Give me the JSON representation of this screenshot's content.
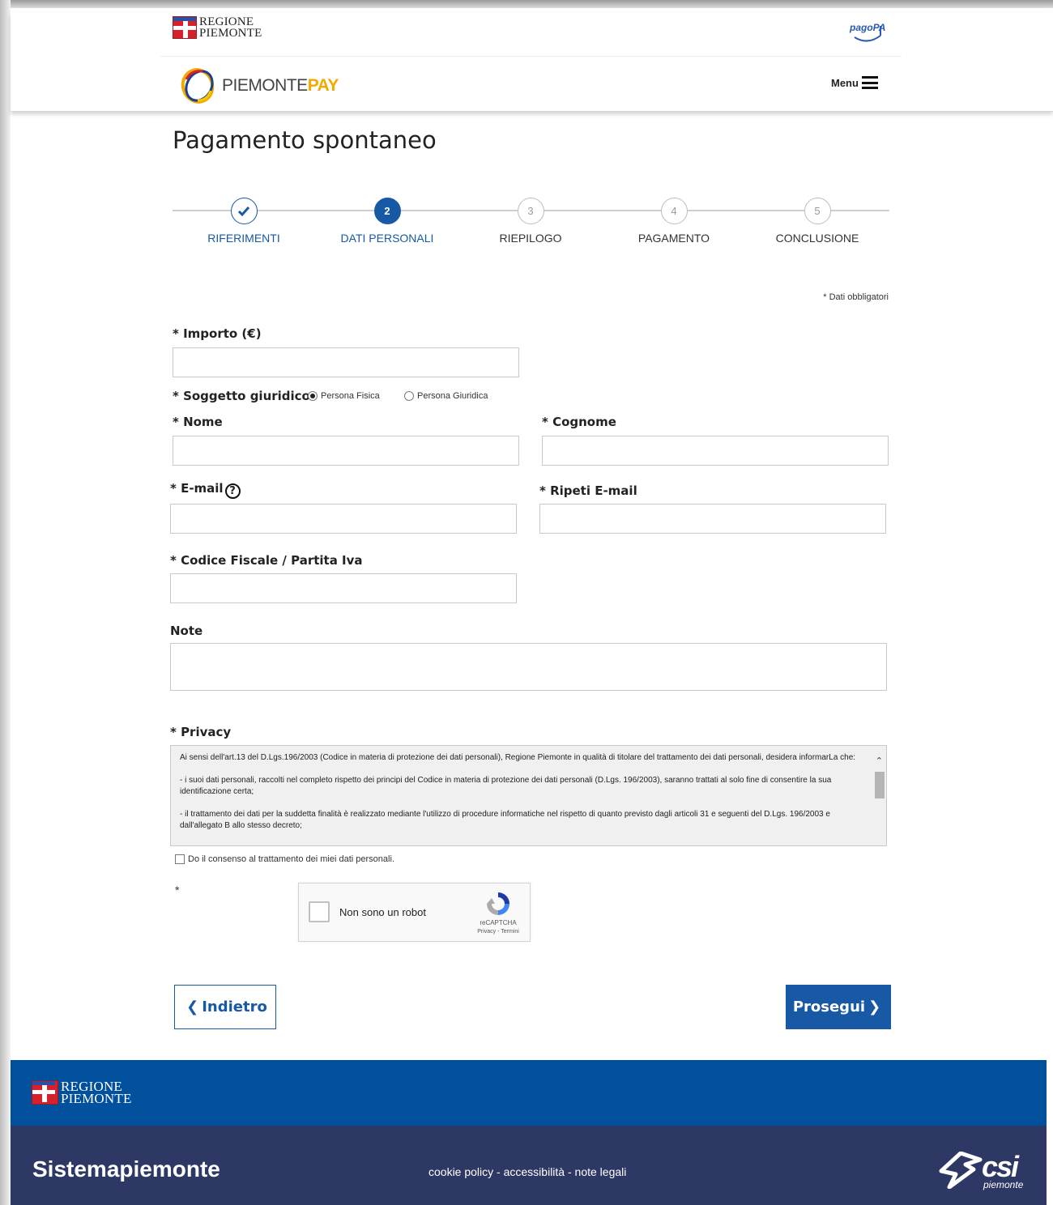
{
  "header": {
    "regione_line1": "REGIONE",
    "regione_line2": "PIEMONTE",
    "pagopa": "pagoPA",
    "brand_main": "PIEMONTE",
    "brand_accent": "PAY",
    "menu_label": "Menu"
  },
  "page_title": "Pagamento spontaneo",
  "stepper": [
    {
      "num": "",
      "label": "RIFERIMENTI",
      "state": "done"
    },
    {
      "num": "2",
      "label": "DATI PERSONALI",
      "state": "active"
    },
    {
      "num": "3",
      "label": "RIEPILOGO",
      "state": "todo"
    },
    {
      "num": "4",
      "label": "PAGAMENTO",
      "state": "todo"
    },
    {
      "num": "5",
      "label": "CONCLUSIONE",
      "state": "todo"
    }
  ],
  "required_note": "* Dati obbligatori",
  "form": {
    "importo_label": "* Importo (€)",
    "importo_value": "",
    "soggetto_label": "* Soggetto giuridico",
    "soggetto_options": [
      "Persona Fisica",
      "Persona Giuridica"
    ],
    "soggetto_selected": "Persona Fisica",
    "nome_label": "* Nome",
    "nome_value": "",
    "cognome_label": "* Cognome",
    "cognome_value": "",
    "email_label": "* E-mail",
    "email_value": "",
    "ripeti_email_label": "* Ripeti E-mail",
    "ripeti_email_value": "",
    "cf_label": "* Codice Fiscale / Partita Iva",
    "cf_value": "",
    "note_label": "Note",
    "note_value": "",
    "privacy_label": "* Privacy",
    "privacy_paragraphs": [
      "Ai sensi dell'art.13 del D.Lgs.196/2003 (Codice in materia di protezione dei dati personali), Regione Piemonte in qualità di titolare del trattamento dei dati personali, desidera informarLa che:",
      "- i suoi dati personali, raccolti nel completo rispetto dei principi del Codice in materia di protezione dei dati personali (D.Lgs. 196/2003), saranno trattati al solo fine di consentire la sua identificazione certa;",
      "- il trattamento dei dati per la suddetta finalità è realizzato mediante l'utilizzo di procedure informatiche nel rispetto di quanto previsto dagli articoli 31 e seguenti del D.Lgs. 196/2003 e dall'allegato B allo stesso decreto;"
    ],
    "consent_label": "Do il consenso al trattamento dei miei dati personali.",
    "captcha_required_mark": "*"
  },
  "recaptcha": {
    "label": "Non sono un robot",
    "brand": "reCAPTCHA",
    "links": "Privacy - Termini"
  },
  "buttons": {
    "back": "Indietro",
    "next": "Prosegui"
  },
  "footer": {
    "regione_line1": "REGIONE",
    "regione_line2": "PIEMONTE",
    "sistema": "Sistemapiemonte",
    "link_cookie": "cookie policy",
    "link_access": "accessibilità",
    "link_legal": "note legali",
    "separator": " - ",
    "csi": "csi",
    "csi_sub": "piemonte"
  },
  "colors": {
    "primary": "#1759a4",
    "footer_top": "#00509e",
    "footer_bottom": "#2d3865",
    "accent_pay": "#f2a900"
  }
}
